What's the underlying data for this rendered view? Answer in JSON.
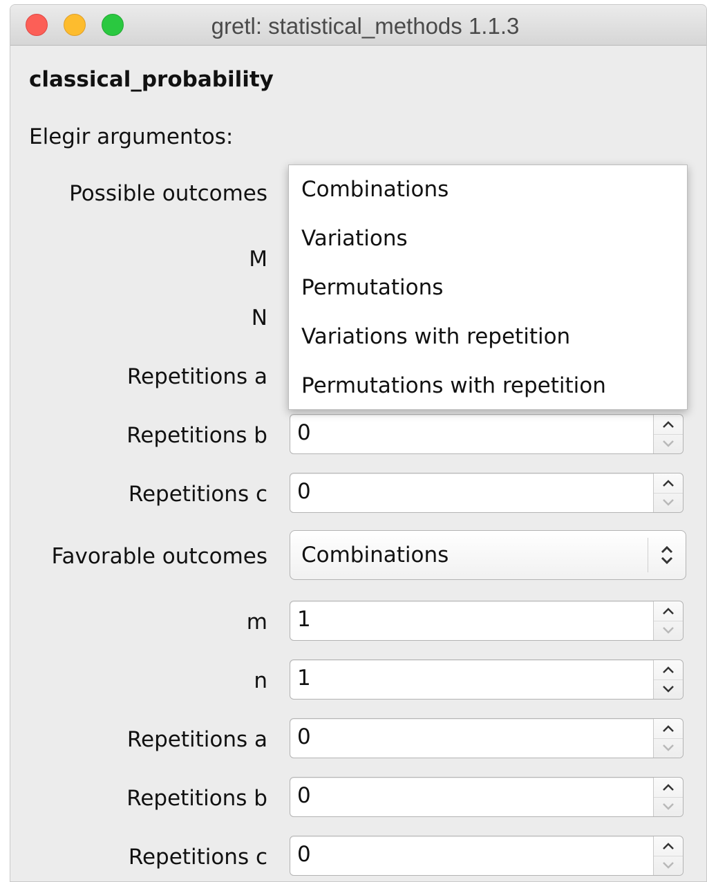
{
  "window": {
    "title": "gretl: statistical_methods 1.1.3"
  },
  "dialog": {
    "heading": "classical_probability",
    "subheading": "Elegir argumentos:"
  },
  "possible": {
    "label": "Possible outcomes",
    "dropdown_options": [
      "Combinations",
      "Variations",
      "Permutations",
      "Variations with repetition",
      "Permutations with repetition"
    ],
    "M_label": "M",
    "N_label": "N",
    "rep_a_label": "Repetitions a",
    "rep_b_label": "Repetitions b",
    "rep_b_value": "0",
    "rep_c_label": "Repetitions c",
    "rep_c_value": "0"
  },
  "favorable": {
    "label": "Favorable outcomes",
    "selected": "Combinations",
    "m_label": "m",
    "m_value": "1",
    "n_label": "n",
    "n_value": "1",
    "rep_a_label": "Repetitions a",
    "rep_a_value": "0",
    "rep_b_label": "Repetitions b",
    "rep_b_value": "0",
    "rep_c_label": "Repetitions c",
    "rep_c_value": "0"
  },
  "icons": {
    "close": "close-window-icon",
    "minimize": "minimize-window-icon",
    "maximize": "maximize-window-icon",
    "step_up": "chevron-up-icon",
    "step_down": "chevron-down-icon",
    "select_arrows": "up-down-chevron-icon"
  },
  "colors": {
    "close": "#fc5f57",
    "minimize": "#fdbc2e",
    "maximize": "#2ac840",
    "window_bg": "#ececec"
  }
}
